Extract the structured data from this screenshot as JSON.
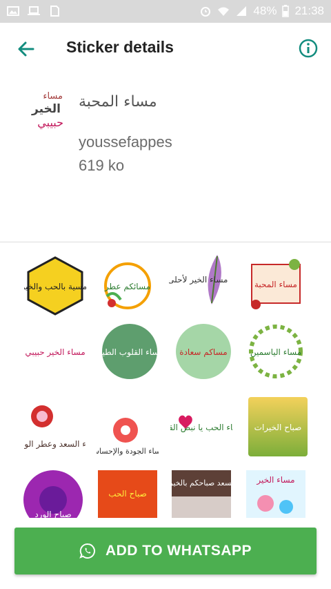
{
  "status_bar": {
    "battery_percent": "48%",
    "time": "21:38"
  },
  "app_bar": {
    "title": "Sticker details"
  },
  "pack": {
    "name": "مساء المحبة",
    "publisher": "youssefappes",
    "size": "619 ko",
    "tray_text": "مساء الخير حبيبي"
  },
  "stickers": [
    {
      "text": "أمسية بالحب والخير"
    },
    {
      "text": "مسائكم عطر"
    },
    {
      "text": "مساء الخير لأحلى طير"
    },
    {
      "text": "مساء المحبة"
    },
    {
      "text": "مساء الخير حبيبي"
    },
    {
      "text": "مساء القلوب الطيبة"
    },
    {
      "text": "مساكم سعادة"
    },
    {
      "text": "مساء الياسمين"
    },
    {
      "text": "مساء السعد وعطر الورد"
    },
    {
      "text": "مساء الجودة والإحساس"
    },
    {
      "text": "مساء الحب يا نبض القلب"
    },
    {
      "text": "صباح الخيرات"
    },
    {
      "text": "صباح الورد"
    },
    {
      "text": "صباح الحب"
    },
    {
      "text": "يسعد صباحكم بالخير"
    },
    {
      "text": "مساء الخير"
    }
  ],
  "actions": {
    "add_label": "ADD TO WHATSAPP"
  },
  "colors": {
    "accent": "#128c7e",
    "button": "#4caf50",
    "status_bar": "#d9d9d9"
  },
  "icons": {
    "back": "arrow-left-icon",
    "info": "info-icon",
    "whatsapp": "whatsapp-icon"
  }
}
